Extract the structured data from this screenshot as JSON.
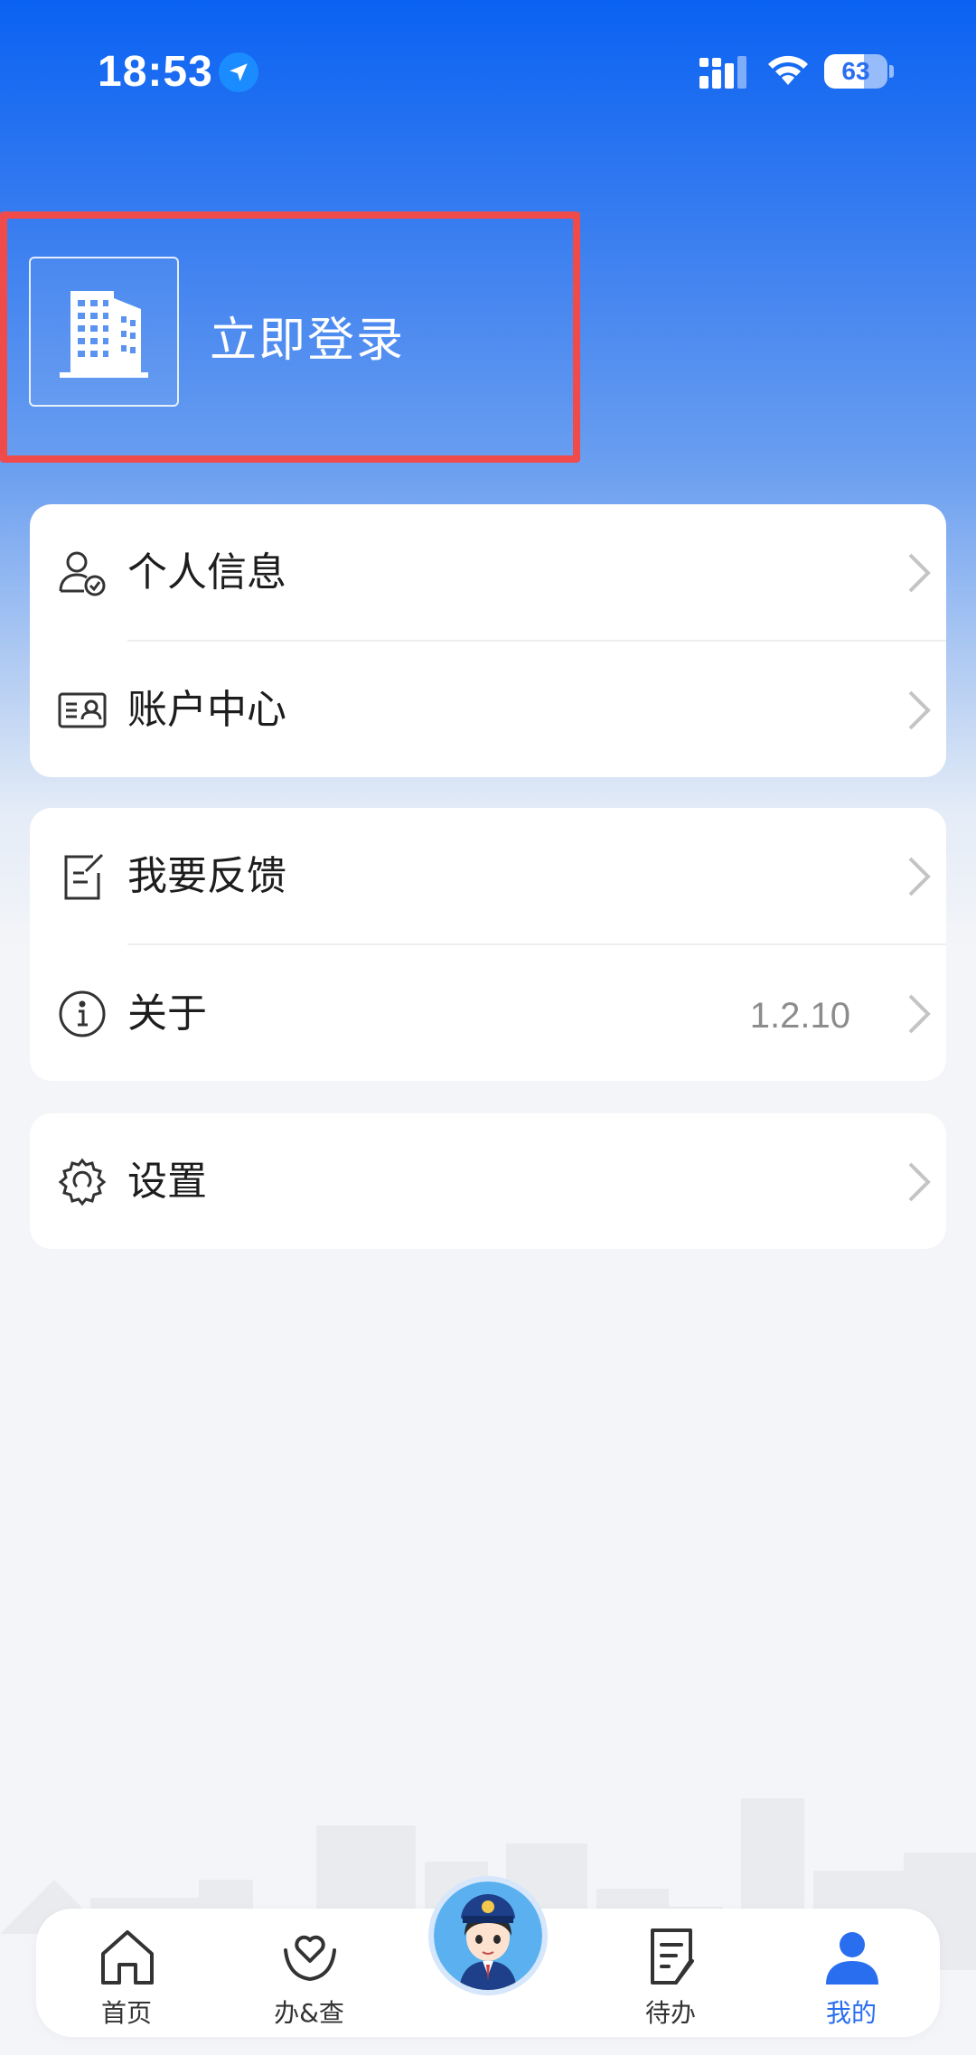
{
  "status_bar": {
    "time": "18:53",
    "battery": "63",
    "battery_level_percent": 63,
    "icons": [
      "location-arrow-icon",
      "cellular-signal-icon",
      "wifi-icon",
      "battery-icon"
    ]
  },
  "header": {
    "login_label": "立即登录",
    "avatar_icon": "building-icon"
  },
  "menu_groups": [
    {
      "items": [
        {
          "label": "个人信息",
          "icon": "user-check-icon"
        },
        {
          "label": "账户中心",
          "icon": "id-card-icon"
        }
      ]
    },
    {
      "items": [
        {
          "label": "我要反馈",
          "icon": "feedback-edit-icon"
        },
        {
          "label": "关于",
          "icon": "info-icon",
          "value": "1.2.10"
        }
      ]
    },
    {
      "items": [
        {
          "label": "设置",
          "icon": "settings-gear-icon"
        }
      ]
    }
  ],
  "tab_bar": {
    "active_color": "#2a6ef0",
    "tabs": [
      {
        "label": "首页",
        "icon": "home-icon"
      },
      {
        "label": "办&查",
        "icon": "heart-hand-icon"
      },
      {
        "label": "",
        "icon": "assistant-avatar-icon"
      },
      {
        "label": "待办",
        "icon": "todo-list-icon"
      },
      {
        "label": "我的",
        "icon": "user-icon",
        "active": true
      }
    ]
  },
  "colors": {
    "header_gradient_top": "#0a62f2",
    "highlight_border": "#ef4b4b",
    "page_background": "#f4f5f8",
    "accent": "#2a6ef0"
  }
}
